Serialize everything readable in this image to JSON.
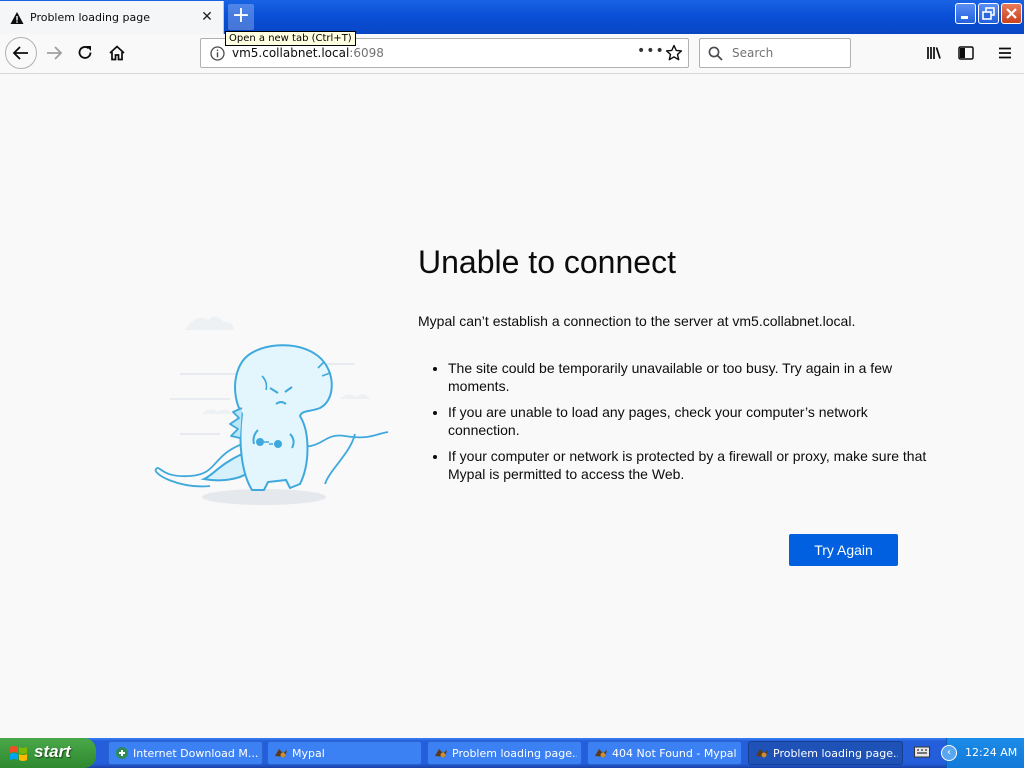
{
  "tabbar": {
    "tab_title": "Problem loading page",
    "tooltip": "Open a new tab (Ctrl+T)"
  },
  "navbar": {
    "url_host": "vm5.collabnet.local",
    "url_port": ":6098",
    "search_placeholder": "Search"
  },
  "content": {
    "title": "Unable to connect",
    "description": "Mypal can’t establish a connection to the server at vm5.collabnet.local.",
    "bullets": [
      "The site could be temporarily unavailable or too busy. Try again in a few moments.",
      "If you are unable to load any pages, check your computer’s network connection.",
      "If your computer or network is protected by a firewall or proxy, make sure that Mypal is permitted to access the Web."
    ],
    "try_again": "Try Again"
  },
  "taskbar": {
    "start_label": "start",
    "tasks": [
      {
        "label": "Internet Download M...",
        "icon": "idm-icon"
      },
      {
        "label": "Mypal",
        "icon": "mypal-icon"
      },
      {
        "label": "Problem loading page...",
        "icon": "mypal-icon"
      },
      {
        "label": "404 Not Found - Mypal",
        "icon": "mypal-icon"
      },
      {
        "label": "Problem loading page...",
        "icon": "mypal-icon"
      }
    ],
    "clock": "12:24 AM"
  }
}
